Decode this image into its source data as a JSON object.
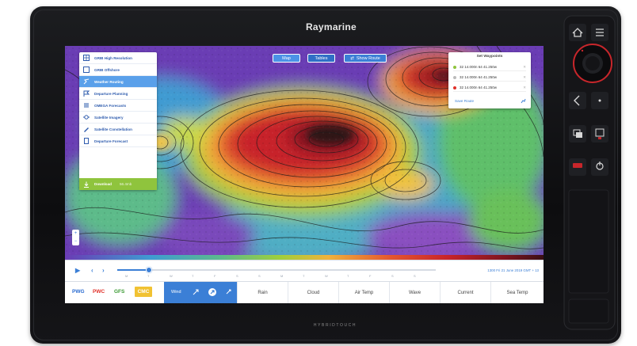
{
  "device": {
    "brand": "Raymarine",
    "subbrand": "HYBRIDTOUCH"
  },
  "map_tabs": [
    {
      "label": "Map"
    },
    {
      "label": "Tables"
    },
    {
      "label": "Show Route"
    }
  ],
  "left_menu": {
    "items": [
      {
        "label": "GRIB High Resolution",
        "icon": "grid-icon",
        "active": false
      },
      {
        "label": "GRIB Offshore",
        "icon": "square-icon",
        "active": false
      },
      {
        "label": "Weather Routing",
        "icon": "route-icon",
        "active": true
      },
      {
        "label": "Departure Planning",
        "icon": "flag-icon",
        "active": false
      },
      {
        "label": "OMEGA Forecasts",
        "icon": "list-icon",
        "active": false
      },
      {
        "label": "Satellite Imagery",
        "icon": "satellite-icon",
        "active": false
      },
      {
        "label": "Satellite Constellation",
        "icon": "pen-icon",
        "active": false
      },
      {
        "label": "Departure Forecast",
        "icon": "doc-icon",
        "active": false
      }
    ],
    "download": {
      "label": "Download",
      "sub": "56.4mb"
    }
  },
  "waypoints": {
    "title": "Set Waypoints",
    "rows": [
      {
        "text": "32 14.000n 64 41.250w",
        "color": "#8fc43d"
      },
      {
        "text": "32 14.000n 64 41.250w",
        "color": "#bbbbbb"
      },
      {
        "text": "32 14.000n 64 41.250w",
        "color": "#e0312a"
      }
    ],
    "save_label": "Save Route"
  },
  "zoom": {
    "plus": "+",
    "minus": "−"
  },
  "timeline": {
    "play": "▶",
    "prev": "‹",
    "next": "›",
    "days": [
      "M",
      "T",
      "W",
      "T",
      "F",
      "S",
      "S",
      "M",
      "T",
      "W",
      "T",
      "F",
      "S",
      "S"
    ],
    "date_text": "1300 Fri 21 June 2019 GMT + 13"
  },
  "sources": {
    "pwg": "PWG",
    "pwc": "PWC",
    "gfs": "GFS",
    "cmc": "CMC"
  },
  "wind": {
    "label": "Wind"
  },
  "layers": [
    {
      "label": "Rain"
    },
    {
      "label": "Cloud"
    },
    {
      "label": "Air Temp"
    },
    {
      "label": "Wave"
    },
    {
      "label": "Current"
    },
    {
      "label": "Sea Temp"
    }
  ],
  "colors": {
    "accent": "#3b7fd6",
    "active_menu": "#5aa0ea",
    "download": "#8fc43d",
    "pwg": "#2a6bd0",
    "pwc": "#e0312a",
    "gfs": "#3b9a33",
    "cmc": "#f1c232"
  }
}
